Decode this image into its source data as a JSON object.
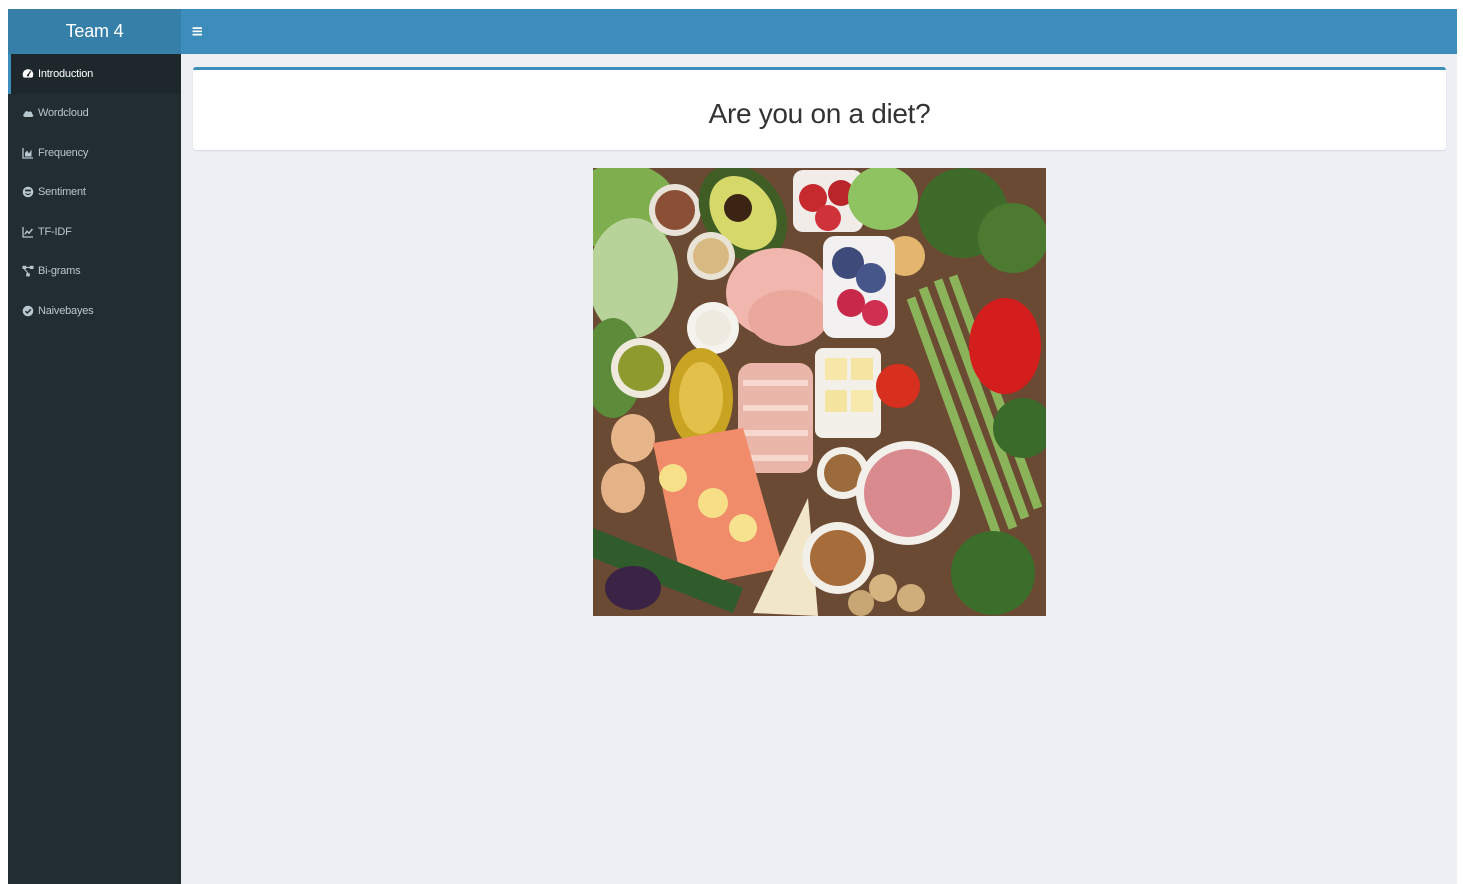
{
  "app": {
    "title": "Team 4"
  },
  "header": {
    "toggle_glyph": "≡",
    "toggle_icon": "hamburger-icon"
  },
  "sidebar": {
    "items": [
      {
        "label": "Introduction",
        "icon": "dashboard-icon",
        "active": true
      },
      {
        "label": "Wordcloud",
        "icon": "cloud-icon",
        "active": false
      },
      {
        "label": "Frequency",
        "icon": "area-chart-icon",
        "active": false
      },
      {
        "label": "Sentiment",
        "icon": "smile-icon",
        "active": false
      },
      {
        "label": "TF-IDF",
        "icon": "line-chart-icon",
        "active": false
      },
      {
        "label": "Bi-grams",
        "icon": "network-icon",
        "active": false
      },
      {
        "label": "Naivebayes",
        "icon": "check-circle-icon",
        "active": false
      }
    ]
  },
  "main": {
    "box_title": "Are you on a diet?",
    "image": {
      "subject": "healthy-food-spread"
    }
  },
  "colors": {
    "header": "#3c8dbc",
    "logo": "#367fa9",
    "sidebar": "#222d32",
    "sidebar_active": "#1e282c",
    "content_bg": "#ecf0f5"
  }
}
